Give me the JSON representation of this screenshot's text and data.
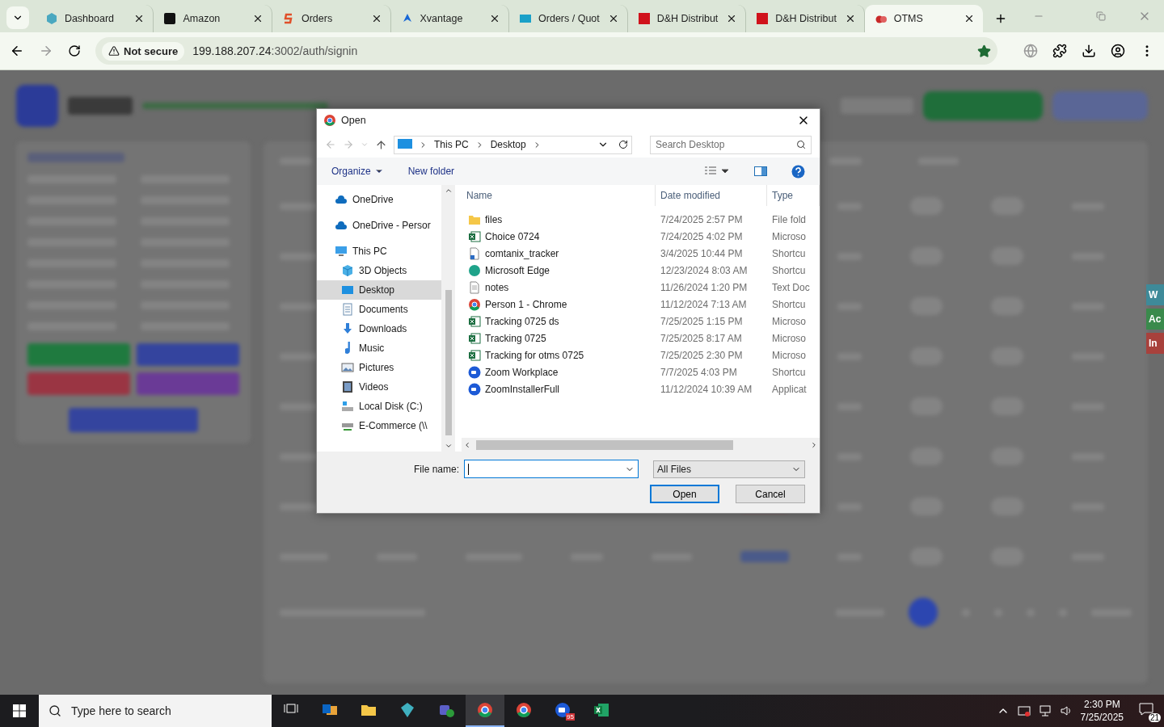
{
  "browser": {
    "tabs": [
      {
        "title": "Dashboard",
        "kind": "hexagon",
        "selected": false
      },
      {
        "title": "Amazon",
        "kind": "amazon",
        "selected": false
      },
      {
        "title": "Orders",
        "kind": "orders",
        "selected": false
      },
      {
        "title": "Xvantage",
        "kind": "xvantage",
        "selected": false
      },
      {
        "title": "Orders / Quot",
        "kind": "ec",
        "selected": false
      },
      {
        "title": "D&H Distribut",
        "kind": "dh",
        "selected": false
      },
      {
        "title": "D&H Distribut",
        "kind": "dh",
        "selected": false
      },
      {
        "title": "OTMS",
        "kind": "otms",
        "selected": true
      }
    ],
    "security": "Not secure",
    "url_host": "199.188.207.24",
    "url_path": ":3002/auth/signin",
    "bookmarked": true
  },
  "page": {
    "side_tabs": [
      {
        "label": "W",
        "color": "#3e8a99"
      },
      {
        "label": "Ac",
        "color": "#3a8a4c"
      },
      {
        "label": "In",
        "color": "#a8413c"
      }
    ]
  },
  "dialog": {
    "title": "Open",
    "breadcrumb": [
      "This PC",
      "Desktop"
    ],
    "search_placeholder": "Search Desktop",
    "toolbar": [
      "Organize",
      "New folder"
    ],
    "nav": [
      {
        "label": "OneDrive",
        "kind": "cloud",
        "selected": false
      },
      {
        "label": "OneDrive - Persor",
        "kind": "cloud",
        "selected": false
      },
      {
        "label": "This PC",
        "kind": "pc",
        "selected": false,
        "children": [
          {
            "label": "3D Objects",
            "kind": "cube",
            "selected": false
          },
          {
            "label": "Desktop",
            "kind": "desktop",
            "selected": true
          },
          {
            "label": "Documents",
            "kind": "docs",
            "selected": false
          },
          {
            "label": "Downloads",
            "kind": "download",
            "selected": false
          },
          {
            "label": "Music",
            "kind": "music",
            "selected": false
          },
          {
            "label": "Pictures",
            "kind": "pictures",
            "selected": false
          },
          {
            "label": "Videos",
            "kind": "videos",
            "selected": false
          },
          {
            "label": "Local Disk (C:)",
            "kind": "disk",
            "selected": false
          },
          {
            "label": "E-Commerce (\\\\",
            "kind": "netdrive",
            "selected": false
          }
        ]
      }
    ],
    "columns": [
      "Name",
      "Date modified",
      "Type"
    ],
    "files": [
      {
        "name": "files",
        "date": "7/24/2025 2:57 PM",
        "type": "File fold",
        "kind": "folder"
      },
      {
        "name": "Choice 0724",
        "date": "7/24/2025 4:02 PM",
        "type": "Microso",
        "kind": "excel"
      },
      {
        "name": "comtanix_tracker",
        "date": "3/4/2025 10:44 PM",
        "type": "Shortcu",
        "kind": "shortcut"
      },
      {
        "name": "Microsoft Edge",
        "date": "12/23/2024 8:03 AM",
        "type": "Shortcu",
        "kind": "edge"
      },
      {
        "name": "notes",
        "date": "11/26/2024 1:20 PM",
        "type": "Text Doc",
        "kind": "text"
      },
      {
        "name": "Person 1 - Chrome",
        "date": "11/12/2024 7:13 AM",
        "type": "Shortcu",
        "kind": "chrome"
      },
      {
        "name": "Tracking 0725 ds",
        "date": "7/25/2025 1:15 PM",
        "type": "Microso",
        "kind": "excel"
      },
      {
        "name": "Tracking 0725",
        "date": "7/25/2025 8:17 AM",
        "type": "Microso",
        "kind": "excel"
      },
      {
        "name": "Tracking for otms 0725",
        "date": "7/25/2025 2:30 PM",
        "type": "Microso",
        "kind": "excel"
      },
      {
        "name": "Zoom Workplace",
        "date": "7/7/2025 4:03 PM",
        "type": "Shortcu",
        "kind": "zoom"
      },
      {
        "name": "ZoomInstallerFull",
        "date": "11/12/2024 10:39 AM",
        "type": "Applicat",
        "kind": "zoom"
      }
    ],
    "file_name_label": "File name:",
    "file_type": "All Files",
    "buttons": [
      "Open",
      "Cancel"
    ]
  },
  "taskbar": {
    "search_placeholder": "Type here to search",
    "apps": [
      {
        "kind": "taskview",
        "active": false
      },
      {
        "kind": "outlook",
        "active": false
      },
      {
        "kind": "explorer",
        "active": false
      },
      {
        "kind": "gem",
        "active": false
      },
      {
        "kind": "teams",
        "active": false
      },
      {
        "kind": "chrome",
        "active": true
      },
      {
        "kind": "chrome",
        "active": false
      },
      {
        "kind": "zoom",
        "active": false,
        "badge": "95"
      },
      {
        "kind": "excel",
        "active": false
      }
    ],
    "time": "2:30 PM",
    "date": "7/25/2025",
    "notifications": "21"
  }
}
